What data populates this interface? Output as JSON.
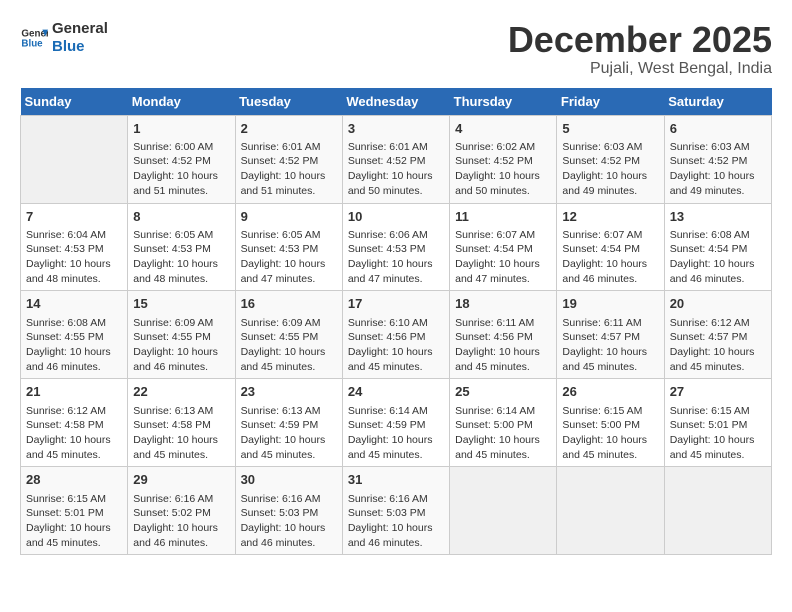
{
  "header": {
    "logo_line1": "General",
    "logo_line2": "Blue",
    "month": "December 2025",
    "location": "Pujali, West Bengal, India"
  },
  "days_of_week": [
    "Sunday",
    "Monday",
    "Tuesday",
    "Wednesday",
    "Thursday",
    "Friday",
    "Saturday"
  ],
  "weeks": [
    [
      {
        "day": "",
        "info": ""
      },
      {
        "day": "1",
        "info": "Sunrise: 6:00 AM\nSunset: 4:52 PM\nDaylight: 10 hours\nand 51 minutes."
      },
      {
        "day": "2",
        "info": "Sunrise: 6:01 AM\nSunset: 4:52 PM\nDaylight: 10 hours\nand 51 minutes."
      },
      {
        "day": "3",
        "info": "Sunrise: 6:01 AM\nSunset: 4:52 PM\nDaylight: 10 hours\nand 50 minutes."
      },
      {
        "day": "4",
        "info": "Sunrise: 6:02 AM\nSunset: 4:52 PM\nDaylight: 10 hours\nand 50 minutes."
      },
      {
        "day": "5",
        "info": "Sunrise: 6:03 AM\nSunset: 4:52 PM\nDaylight: 10 hours\nand 49 minutes."
      },
      {
        "day": "6",
        "info": "Sunrise: 6:03 AM\nSunset: 4:52 PM\nDaylight: 10 hours\nand 49 minutes."
      }
    ],
    [
      {
        "day": "7",
        "info": "Sunrise: 6:04 AM\nSunset: 4:53 PM\nDaylight: 10 hours\nand 48 minutes."
      },
      {
        "day": "8",
        "info": "Sunrise: 6:05 AM\nSunset: 4:53 PM\nDaylight: 10 hours\nand 48 minutes."
      },
      {
        "day": "9",
        "info": "Sunrise: 6:05 AM\nSunset: 4:53 PM\nDaylight: 10 hours\nand 47 minutes."
      },
      {
        "day": "10",
        "info": "Sunrise: 6:06 AM\nSunset: 4:53 PM\nDaylight: 10 hours\nand 47 minutes."
      },
      {
        "day": "11",
        "info": "Sunrise: 6:07 AM\nSunset: 4:54 PM\nDaylight: 10 hours\nand 47 minutes."
      },
      {
        "day": "12",
        "info": "Sunrise: 6:07 AM\nSunset: 4:54 PM\nDaylight: 10 hours\nand 46 minutes."
      },
      {
        "day": "13",
        "info": "Sunrise: 6:08 AM\nSunset: 4:54 PM\nDaylight: 10 hours\nand 46 minutes."
      }
    ],
    [
      {
        "day": "14",
        "info": "Sunrise: 6:08 AM\nSunset: 4:55 PM\nDaylight: 10 hours\nand 46 minutes."
      },
      {
        "day": "15",
        "info": "Sunrise: 6:09 AM\nSunset: 4:55 PM\nDaylight: 10 hours\nand 46 minutes."
      },
      {
        "day": "16",
        "info": "Sunrise: 6:09 AM\nSunset: 4:55 PM\nDaylight: 10 hours\nand 45 minutes."
      },
      {
        "day": "17",
        "info": "Sunrise: 6:10 AM\nSunset: 4:56 PM\nDaylight: 10 hours\nand 45 minutes."
      },
      {
        "day": "18",
        "info": "Sunrise: 6:11 AM\nSunset: 4:56 PM\nDaylight: 10 hours\nand 45 minutes."
      },
      {
        "day": "19",
        "info": "Sunrise: 6:11 AM\nSunset: 4:57 PM\nDaylight: 10 hours\nand 45 minutes."
      },
      {
        "day": "20",
        "info": "Sunrise: 6:12 AM\nSunset: 4:57 PM\nDaylight: 10 hours\nand 45 minutes."
      }
    ],
    [
      {
        "day": "21",
        "info": "Sunrise: 6:12 AM\nSunset: 4:58 PM\nDaylight: 10 hours\nand 45 minutes."
      },
      {
        "day": "22",
        "info": "Sunrise: 6:13 AM\nSunset: 4:58 PM\nDaylight: 10 hours\nand 45 minutes."
      },
      {
        "day": "23",
        "info": "Sunrise: 6:13 AM\nSunset: 4:59 PM\nDaylight: 10 hours\nand 45 minutes."
      },
      {
        "day": "24",
        "info": "Sunrise: 6:14 AM\nSunset: 4:59 PM\nDaylight: 10 hours\nand 45 minutes."
      },
      {
        "day": "25",
        "info": "Sunrise: 6:14 AM\nSunset: 5:00 PM\nDaylight: 10 hours\nand 45 minutes."
      },
      {
        "day": "26",
        "info": "Sunrise: 6:15 AM\nSunset: 5:00 PM\nDaylight: 10 hours\nand 45 minutes."
      },
      {
        "day": "27",
        "info": "Sunrise: 6:15 AM\nSunset: 5:01 PM\nDaylight: 10 hours\nand 45 minutes."
      }
    ],
    [
      {
        "day": "28",
        "info": "Sunrise: 6:15 AM\nSunset: 5:01 PM\nDaylight: 10 hours\nand 45 minutes."
      },
      {
        "day": "29",
        "info": "Sunrise: 6:16 AM\nSunset: 5:02 PM\nDaylight: 10 hours\nand 46 minutes."
      },
      {
        "day": "30",
        "info": "Sunrise: 6:16 AM\nSunset: 5:03 PM\nDaylight: 10 hours\nand 46 minutes."
      },
      {
        "day": "31",
        "info": "Sunrise: 6:16 AM\nSunset: 5:03 PM\nDaylight: 10 hours\nand 46 minutes."
      },
      {
        "day": "",
        "info": ""
      },
      {
        "day": "",
        "info": ""
      },
      {
        "day": "",
        "info": ""
      }
    ]
  ]
}
